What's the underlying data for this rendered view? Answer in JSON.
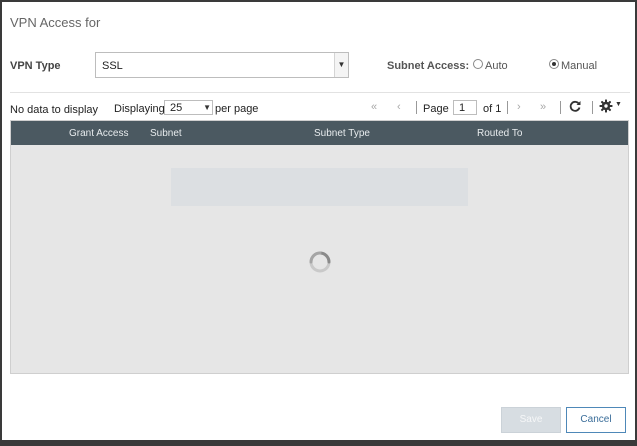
{
  "dialog": {
    "title": "VPN Access for"
  },
  "vpn": {
    "type_label": "VPN Type",
    "type_value": "SSL"
  },
  "subnet_access": {
    "label": "Subnet Access:",
    "options": [
      {
        "label": "Auto",
        "selected": false
      },
      {
        "label": "Manual",
        "selected": true
      }
    ]
  },
  "toolbar": {
    "no_data": "No data to display",
    "displaying": "Displaying",
    "page_size": "25",
    "per_page": "per page",
    "page_label": "Page",
    "page_number": "1",
    "of_label": "of 1"
  },
  "grid": {
    "columns": [
      "Grant Access",
      "Subnet",
      "Subnet Type",
      "Routed To"
    ],
    "rows": []
  },
  "buttons": {
    "save": "Save",
    "cancel": "Cancel"
  },
  "icons": {
    "first": "first-page-icon",
    "prev": "prev-page-icon",
    "next": "next-page-icon",
    "last": "last-page-icon",
    "refresh": "refresh-icon",
    "settings": "gear-icon",
    "loading": "loading-spinner-icon"
  },
  "colors": {
    "grid_header": "#4b5961",
    "accent": "#4e88b8"
  }
}
